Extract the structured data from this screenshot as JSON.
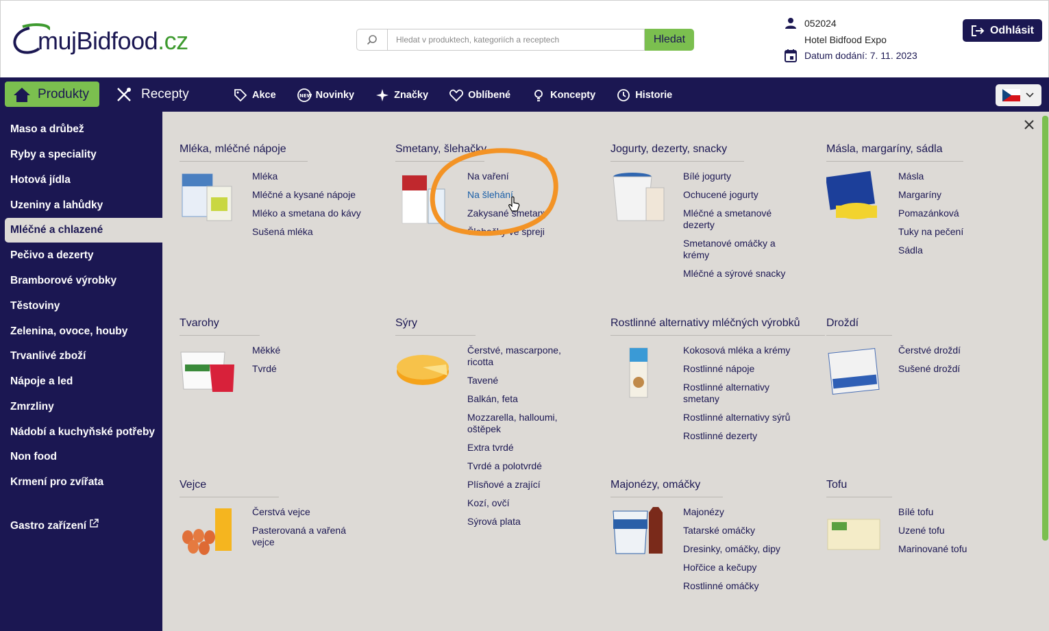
{
  "header": {
    "logo_main": "mujBidfood",
    "logo_suffix": ".cz",
    "search_placeholder": "Hledat v produktech, kategoriích a receptech",
    "search_button": "Hledat",
    "customer_id": "052024",
    "customer_name": "Hotel Bidfood Expo",
    "delivery_date": "Datum dodání: 7. 11. 2023",
    "logout": "Odhlásit"
  },
  "nav": {
    "produkty": "Produkty",
    "recepty": "Recepty",
    "links": [
      "Akce",
      "Novinky",
      "Značky",
      "Oblíbené",
      "Koncepty",
      "Historie"
    ]
  },
  "sidebar": {
    "items": [
      "Maso a drůbež",
      "Ryby a speciality",
      "Hotová jídla",
      "Uzeniny a lahůdky",
      "Mléčné a chlazené",
      "Pečivo a dezerty",
      "Bramborové výrobky",
      "Těstoviny",
      "Zelenina, ovoce, houby",
      "Trvanlivé zboží",
      "Nápoje a led",
      "Zmrzliny",
      "Nádobí a kuchyňské potřeby",
      "Non food",
      "Krmení pro zvířata"
    ],
    "active": "Mléčné a chlazené",
    "gastro": "Gastro zařízení"
  },
  "categories": [
    {
      "title": "Mléka, mléčné nápoje",
      "items": [
        "Mléka",
        "Mléčné a kysané nápoje",
        "Mléko a smetana do kávy",
        "Sušená mléka"
      ]
    },
    {
      "title": "Smetany, šlehačky",
      "items": [
        "Na vaření",
        "Na šlehání",
        "Zakysané smetany",
        "Šlehačky ve spreji"
      ]
    },
    {
      "title": "Jogurty, dezerty, snacky",
      "items": [
        "Bílé jogurty",
        "Ochucené jogurty",
        "Mléčné a smetanové dezerty",
        "Smetanové omáčky a krémy",
        "Mléčné a sýrové snacky"
      ]
    },
    {
      "title": "Másla, margaríny, sádla",
      "items": [
        "Másla",
        "Margaríny",
        "Pomazánková",
        "Tuky na pečení",
        "Sádla"
      ]
    },
    {
      "title": "Tvarohy",
      "items": [
        "Měkké",
        "Tvrdé"
      ]
    },
    {
      "title": "Sýry",
      "items": [
        "Čerstvé, mascarpone, ricotta",
        "Tavené",
        "Balkán, feta",
        "Mozzarella, halloumi, oštěpek",
        "Extra tvrdé",
        "Tvrdé a polotvrdé",
        "Plísňové a zrající",
        "Kozí, ovčí",
        "Sýrová plata"
      ]
    },
    {
      "title": "Rostlinné alternativy mléčných výrobků",
      "items": [
        "Kokosová mléka a krémy",
        "Rostlinné nápoje",
        "Rostlinné alternativy smetany",
        "Rostlinné alternativy sýrů",
        "Rostlinné dezerty"
      ]
    },
    {
      "title": "Droždí",
      "items": [
        "Čerstvé droždí",
        "Sušené droždí"
      ]
    },
    {
      "title": "Vejce",
      "items": [
        "Čerstvá vejce",
        "Pasterovaná a vařená vejce"
      ]
    },
    {
      "title": "Majonézy, omáčky",
      "items": [
        "Majonézy",
        "Tatarské omáčky",
        "Dresinky, omáčky, dipy",
        "Hořčice a kečupy",
        "Rostlinné omáčky"
      ]
    },
    {
      "title": "Tofu",
      "items": [
        "Bílé tofu",
        "Uzené tofu",
        "Marinované tofu"
      ]
    }
  ],
  "highlighted_item": "Na šlehání",
  "colors": {
    "navy": "#1b1752",
    "green": "#7bbf4f",
    "panel": "#dddad6",
    "annotation": "#f39325",
    "link_hover": "#1a5fa8"
  }
}
